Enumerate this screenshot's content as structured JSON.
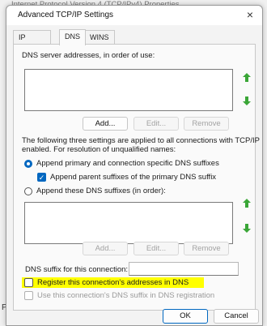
{
  "background": {
    "title": "Internet Protocol Version 4 (TCP/IPv4) Properties",
    "bottom_text": "Pr"
  },
  "dialog": {
    "title": "Advanced TCP/IP Settings",
    "close": "×"
  },
  "tabs": [
    {
      "label": "IP Settings"
    },
    {
      "label": "DNS"
    },
    {
      "label": "WINS"
    }
  ],
  "dns_servers": {
    "label": "DNS server addresses, in order of use:",
    "add": "Add...",
    "edit": "Edit...",
    "remove": "Remove"
  },
  "info_text": {
    "line1": "The following three settings are applied to all connections with TCP/IP",
    "line2": "enabled. For resolution of unqualified names:"
  },
  "options": {
    "append_primary": "Append primary and connection specific DNS suffixes",
    "append_parent": "Append parent suffixes of the primary DNS suffix",
    "append_these": "Append these DNS suffixes (in order):"
  },
  "suffixes": {
    "add": "Add...",
    "edit": "Edit...",
    "remove": "Remove"
  },
  "connection_suffix": {
    "label": "DNS suffix for this connection:",
    "value": ""
  },
  "register": {
    "label": "Register this connection's addresses in DNS",
    "use_suffix": "Use this connection's DNS suffix in DNS registration"
  },
  "footer": {
    "ok": "OK",
    "cancel": "Cancel"
  },
  "colors": {
    "accent": "#0067c0",
    "arrow_green": "#3aa637",
    "highlight": "#ffff00"
  }
}
